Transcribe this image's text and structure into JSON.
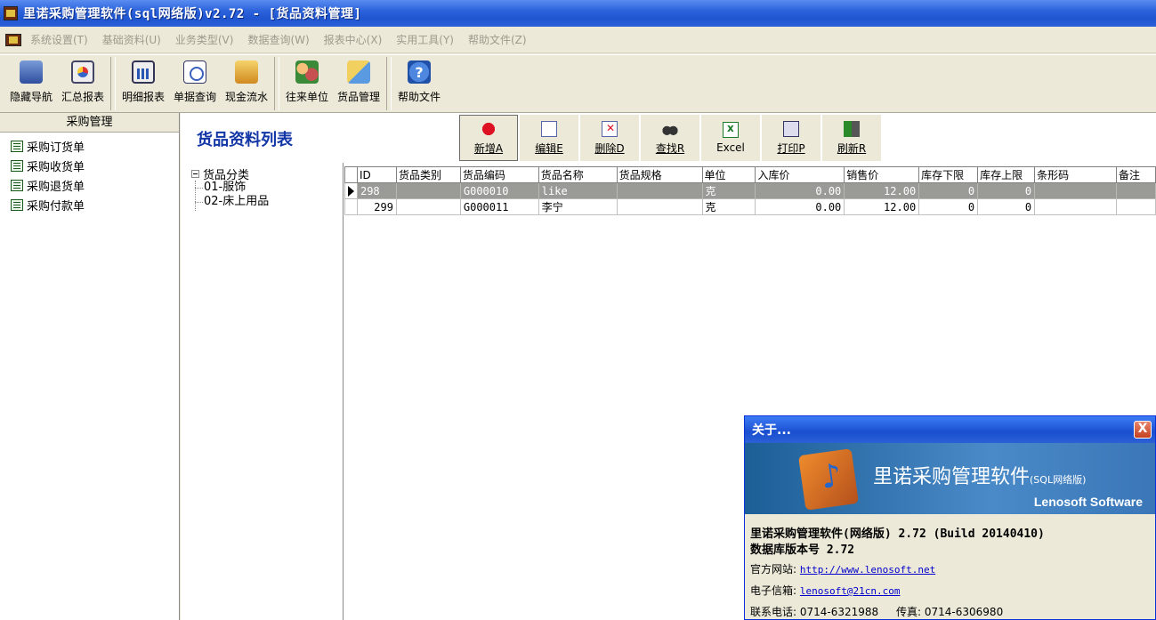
{
  "window": {
    "title": "里诺采购管理软件(sql网络版)v2.72 - [货品资料管理]"
  },
  "menu": [
    "系统设置(T)",
    "基础资料(U)",
    "业务类型(V)",
    "数据查询(W)",
    "报表中心(X)",
    "实用工具(Y)",
    "帮助文件(Z)"
  ],
  "toolbar": {
    "buttons": [
      {
        "label": "隐藏导航",
        "icon": "monitor-icon"
      },
      {
        "label": "汇总报表",
        "icon": "pie-chart-icon"
      },
      {
        "label": "明细报表",
        "icon": "bar-chart-icon"
      },
      {
        "label": "单据查询",
        "icon": "document-search-icon"
      },
      {
        "label": "现金流水",
        "icon": "cash-icon"
      },
      {
        "label": "往来单位",
        "icon": "people-icon"
      },
      {
        "label": "货品管理",
        "icon": "goods-icon"
      },
      {
        "label": "帮助文件",
        "icon": "help-icon"
      }
    ]
  },
  "sidebar": {
    "header": "采购管理",
    "items": [
      "采购订货单",
      "采购收货单",
      "采购退货单",
      "采购付款单"
    ]
  },
  "content": {
    "title": "货品资料列表",
    "actions": [
      {
        "label": "新增A",
        "icon": "add-icon"
      },
      {
        "label": "编辑E",
        "icon": "edit-icon"
      },
      {
        "label": "删除D",
        "icon": "delete-icon"
      },
      {
        "label": "查找R",
        "icon": "find-icon"
      },
      {
        "label": "Excel",
        "icon": "excel-icon"
      },
      {
        "label": "打印P",
        "icon": "print-icon"
      },
      {
        "label": "刷新R",
        "icon": "refresh-icon"
      }
    ],
    "tree": {
      "root": "货品分类",
      "children": [
        "01-服饰",
        "02-床上用品"
      ]
    },
    "table": {
      "columns": [
        "ID",
        "货品类别",
        "货品编码",
        "货品名称",
        "货品规格",
        "单位",
        "入库价",
        "销售价",
        "库存下限",
        "库存上限",
        "条形码",
        "备注"
      ],
      "rows": [
        [
          "298",
          "",
          "G000010",
          "like",
          "",
          "克",
          "0.00",
          "12.00",
          "0",
          "0",
          "",
          ""
        ],
        [
          "299",
          "",
          "G000011",
          "李宁",
          "",
          "克",
          "0.00",
          "12.00",
          "0",
          "0",
          "",
          ""
        ]
      ]
    }
  },
  "about": {
    "title": "关于...",
    "close": "X",
    "app_name": "里诺采购管理软件",
    "app_edition": "(SQL网络版)",
    "company": "Lenosoft Software",
    "version_line": "里诺采购管理软件(网络版) 2.72 (Build 20140410)",
    "db_version_line": "数据库版本号 2.72",
    "website_label": "官方网站:",
    "website": "http://www.lenosoft.net",
    "email_label": "电子信箱:",
    "email": "lenosoft@21cn.com",
    "phone_label": "联系电话:",
    "phone": "0714-6321988",
    "fax_label": "传真:",
    "fax": "0714-6306980"
  }
}
